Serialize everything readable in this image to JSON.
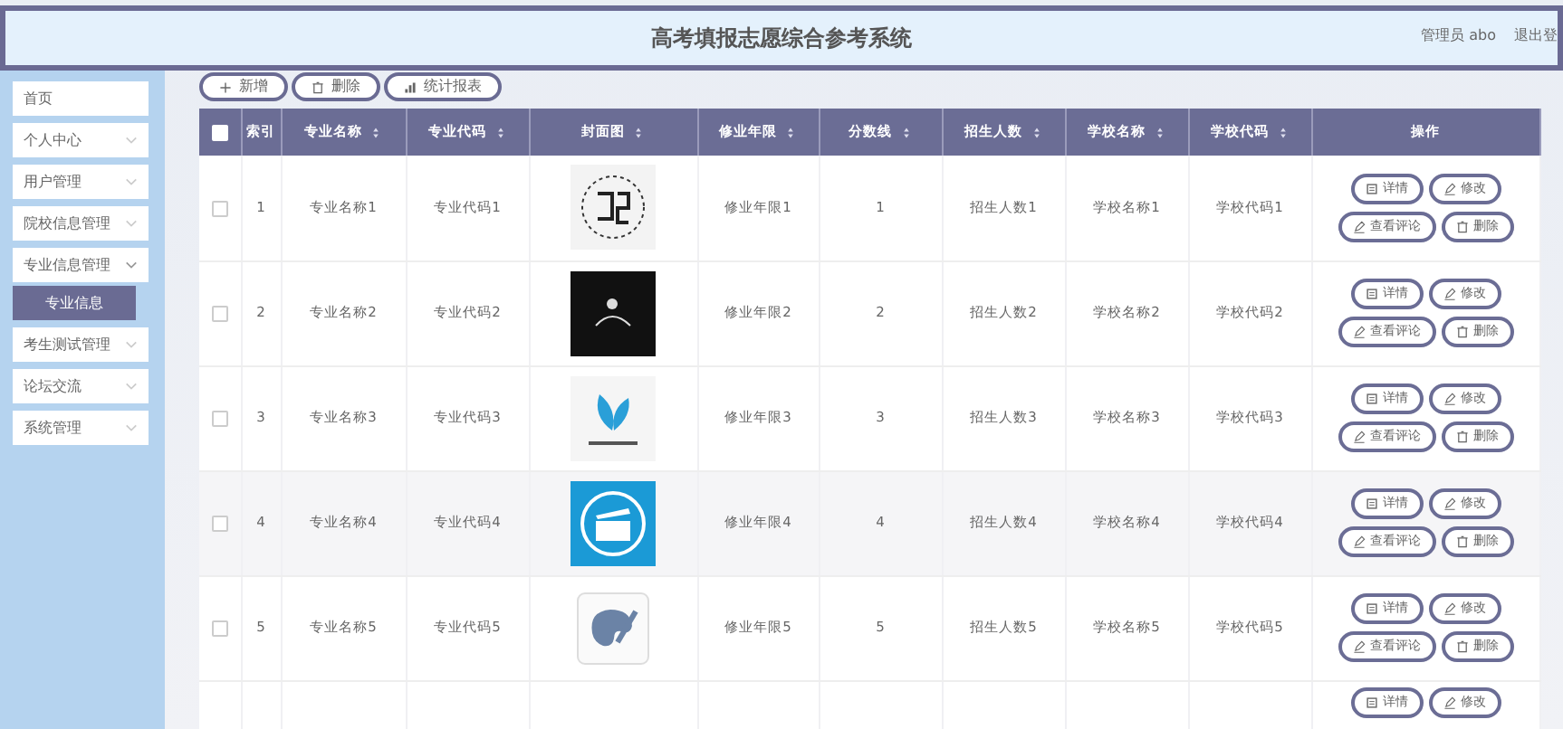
{
  "header": {
    "title": "高考填报志愿综合参考系统",
    "user": "管理员 abo",
    "logout": "退出登"
  },
  "sidebar": {
    "items": [
      {
        "label": "首页",
        "expandable": false,
        "selected": false
      },
      {
        "label": "个人中心",
        "expandable": true,
        "expanded": false,
        "selected": false
      },
      {
        "label": "用户管理",
        "expandable": true,
        "expanded": false,
        "selected": false
      },
      {
        "label": "院校信息管理",
        "expandable": true,
        "expanded": false,
        "selected": false
      },
      {
        "label": "专业信息管理",
        "expandable": true,
        "expanded": true,
        "selected": false,
        "children": [
          {
            "label": "专业信息",
            "selected": true
          }
        ]
      },
      {
        "label": "考生测试管理",
        "expandable": true,
        "expanded": false,
        "selected": false
      },
      {
        "label": "论坛交流",
        "expandable": true,
        "expanded": false,
        "selected": false
      },
      {
        "label": "系统管理",
        "expandable": true,
        "expanded": false,
        "selected": false
      }
    ]
  },
  "toolbar": [
    {
      "kind": "add",
      "label": "新增"
    },
    {
      "kind": "delete",
      "label": "删除"
    },
    {
      "kind": "report",
      "label": "统计报表"
    }
  ],
  "table": {
    "all_checked": false,
    "columns": [
      {
        "label": "索引",
        "sortable": false
      },
      {
        "label": "专业名称",
        "sortable": true
      },
      {
        "label": "专业代码",
        "sortable": true
      },
      {
        "label": "封面图",
        "sortable": true
      },
      {
        "label": "修业年限",
        "sortable": true
      },
      {
        "label": "分数线",
        "sortable": true
      },
      {
        "label": "招生人数",
        "sortable": true
      },
      {
        "label": "学校名称",
        "sortable": true
      },
      {
        "label": "学校代码",
        "sortable": true
      },
      {
        "label": "操作",
        "sortable": false
      }
    ],
    "rows": [
      {
        "checked": false,
        "index": "1",
        "major_name": "专业名称1",
        "major_code": "专业代码1",
        "years": "修业年限1",
        "score": "1",
        "enrollment": "招生人数1",
        "school_name": "学校名称1",
        "school_code": "学校代码1",
        "actions": [
          {
            "kind": "detail",
            "label": "详情"
          },
          {
            "kind": "edit",
            "label": "修改"
          },
          {
            "kind": "edit",
            "label": "查看评论"
          },
          {
            "kind": "delete",
            "label": "删除"
          }
        ]
      },
      {
        "checked": false,
        "index": "2",
        "major_name": "专业名称2",
        "major_code": "专业代码2",
        "years": "修业年限2",
        "score": "2",
        "enrollment": "招生人数2",
        "school_name": "学校名称2",
        "school_code": "学校代码2",
        "actions": [
          {
            "kind": "detail",
            "label": "详情"
          },
          {
            "kind": "edit",
            "label": "修改"
          },
          {
            "kind": "edit",
            "label": "查看评论"
          },
          {
            "kind": "delete",
            "label": "删除"
          }
        ]
      },
      {
        "checked": false,
        "index": "3",
        "major_name": "专业名称3",
        "major_code": "专业代码3",
        "years": "修业年限3",
        "score": "3",
        "enrollment": "招生人数3",
        "school_name": "学校名称3",
        "school_code": "学校代码3",
        "actions": [
          {
            "kind": "detail",
            "label": "详情"
          },
          {
            "kind": "edit",
            "label": "修改"
          },
          {
            "kind": "edit",
            "label": "查看评论"
          },
          {
            "kind": "delete",
            "label": "删除"
          }
        ]
      },
      {
        "checked": false,
        "index": "4",
        "major_name": "专业名称4",
        "major_code": "专业代码4",
        "years": "修业年限4",
        "score": "4",
        "enrollment": "招生人数4",
        "school_name": "学校名称4",
        "school_code": "学校代码4",
        "actions": [
          {
            "kind": "detail",
            "label": "详情"
          },
          {
            "kind": "edit",
            "label": "修改"
          },
          {
            "kind": "edit",
            "label": "查看评论"
          },
          {
            "kind": "delete",
            "label": "删除"
          }
        ]
      },
      {
        "checked": false,
        "index": "5",
        "major_name": "专业名称5",
        "major_code": "专业代码5",
        "years": "修业年限5",
        "score": "5",
        "enrollment": "招生人数5",
        "school_name": "学校名称5",
        "school_code": "学校代码5",
        "actions": [
          {
            "kind": "detail",
            "label": "详情"
          },
          {
            "kind": "edit",
            "label": "修改"
          },
          {
            "kind": "edit",
            "label": "查看评论"
          },
          {
            "kind": "delete",
            "label": "删除"
          }
        ]
      },
      {
        "actions": [
          {
            "kind": "detail",
            "label": "详情"
          },
          {
            "kind": "edit",
            "label": "修改"
          }
        ]
      }
    ]
  }
}
